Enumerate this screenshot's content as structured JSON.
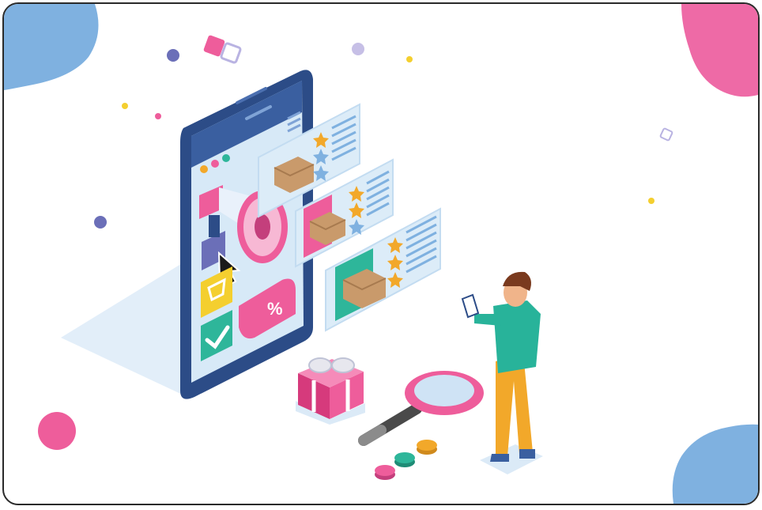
{
  "scene": {
    "discount_badge_text": "%",
    "colors": {
      "frame_border": "#2a2a2a",
      "phone_body": "#2c4c87",
      "phone_screen": "#d7e9f7",
      "accent_pink": "#ee5d9b",
      "accent_blue": "#7fb1e0",
      "accent_yellow": "#f4cf2f",
      "accent_green": "#2eb69a",
      "accent_purple": "#6b6fb8",
      "card_bg": "#dcecf8",
      "box_brown": "#c99a6b",
      "person_shirt": "#28b39a",
      "person_pants": "#f2a82a",
      "person_hair": "#7a3a1e"
    },
    "icons": [
      "megaphone-icon",
      "cursor-icon",
      "cart-icon",
      "check-icon",
      "gift-icon",
      "magnifier-icon",
      "star-icon",
      "package-icon",
      "percent-tag-icon",
      "coin-icon"
    ],
    "review_cards": [
      {
        "stars": 3
      },
      {
        "stars": 3
      },
      {
        "stars": 3
      }
    ]
  }
}
